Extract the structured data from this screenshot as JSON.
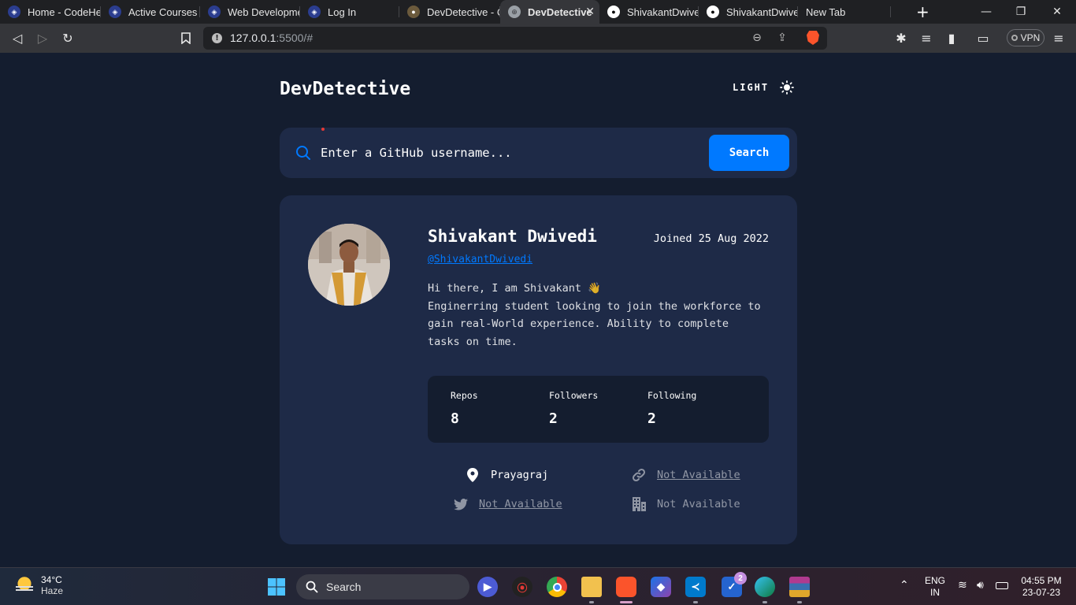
{
  "browser": {
    "tabs": [
      {
        "label": "Home - CodeHelp",
        "favicon": "codehelp-icon"
      },
      {
        "label": "Active Courses",
        "favicon": "codehelp-icon"
      },
      {
        "label": "Web Development",
        "favicon": "codehelp-icon"
      },
      {
        "label": "Log In",
        "favicon": "codehelp-icon"
      },
      {
        "label": "DevDetective - Co",
        "favicon": "detective-icon"
      },
      {
        "label": "DevDetective",
        "favicon": "globe-icon",
        "active": true
      },
      {
        "label": "ShivakantDwivedi",
        "favicon": "github-icon"
      },
      {
        "label": "ShivakantDwivedi",
        "favicon": "github-icon"
      },
      {
        "label": "New Tab",
        "favicon": ""
      }
    ],
    "url_host": "127.0.0.1",
    "url_rest": ":5500/#",
    "vpn_label": "VPN"
  },
  "app": {
    "brand": "DevDetective",
    "theme_label": "LIGHT",
    "search": {
      "placeholder": "Enter a GitHub username...",
      "button_label": "Search"
    }
  },
  "profile": {
    "name": "Shivakant Dwivedi",
    "joined": "Joined 25 Aug 2022",
    "username": "@ShivakantDwivedi",
    "bio_lines": [
      "Hi there, I am Shivakant 👋",
      "Enginerring student looking to join the workforce to",
      "gain real-World experience. Ability to complete",
      "tasks on time."
    ],
    "stats": {
      "repos_label": "Repos",
      "repos_value": "8",
      "followers_label": "Followers",
      "followers_value": "2",
      "following_label": "Following",
      "following_value": "2"
    },
    "location": "Prayagraj",
    "website": "Not Available",
    "twitter": "Not Available",
    "company": "Not Available"
  },
  "taskbar": {
    "temperature": "34°C",
    "condition": "Haze",
    "search_label": "Search",
    "lang_top": "ENG",
    "lang_bottom": "IN",
    "time": "04:55 PM",
    "date": "23-07-23",
    "todo_badge": "2"
  },
  "colors": {
    "page_bg": "#141d2f",
    "card_bg": "#1e2a47",
    "accent": "#0079ff"
  }
}
